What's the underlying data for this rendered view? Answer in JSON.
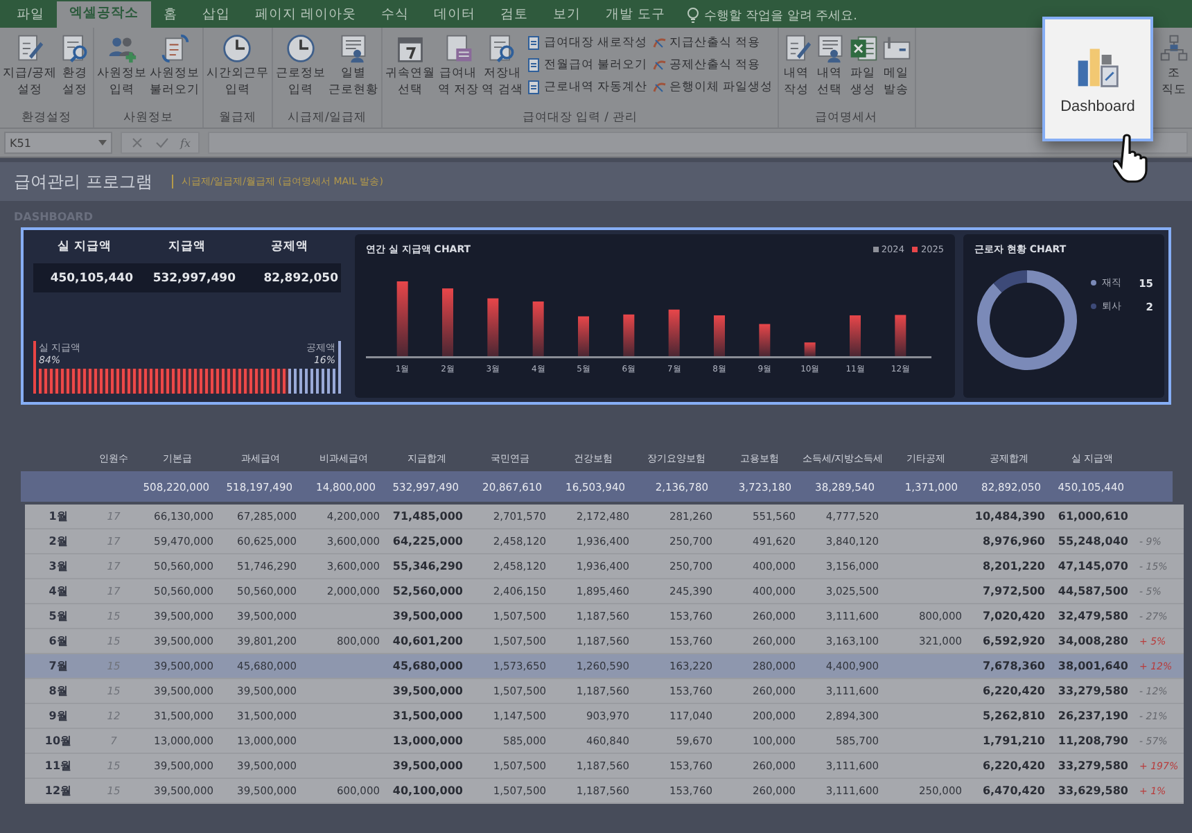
{
  "ribbon_tabs": [
    {
      "label": "파일",
      "selected": false
    },
    {
      "label": "엑셀공작소",
      "selected": true
    },
    {
      "label": "홈",
      "selected": false
    },
    {
      "label": "삽입",
      "selected": false
    },
    {
      "label": "페이지 레이아웃",
      "selected": false
    },
    {
      "label": "수식",
      "selected": false
    },
    {
      "label": "데이터",
      "selected": false
    },
    {
      "label": "검토",
      "selected": false
    },
    {
      "label": "보기",
      "selected": false
    },
    {
      "label": "개발 도구",
      "selected": false
    }
  ],
  "tell_me": "수행할 작업을 알려 주세요.",
  "ribbon_groups": [
    {
      "label": "환경설정",
      "buttons": [
        {
          "lines": [
            "지급/공제",
            "설정"
          ]
        },
        {
          "lines": [
            "환경",
            "설정"
          ]
        }
      ]
    },
    {
      "label": "사원정보",
      "buttons": [
        {
          "lines": [
            "사원정보",
            "입력"
          ]
        },
        {
          "lines": [
            "사원정보",
            "불러오기"
          ]
        }
      ]
    },
    {
      "label": "월급제",
      "buttons": [
        {
          "lines": [
            "시간외근무",
            "입력"
          ]
        }
      ]
    },
    {
      "label": "시급제/일급제",
      "buttons": [
        {
          "lines": [
            "근로정보",
            "입력"
          ]
        },
        {
          "lines": [
            "일별",
            "근로현황"
          ]
        }
      ]
    },
    {
      "label": "급여대장 입력 / 관리",
      "buttons": [
        {
          "lines": [
            "귀속연월",
            "선택"
          ]
        },
        {
          "lines": [
            "급여내",
            "역 저장"
          ]
        },
        {
          "lines": [
            "저장내",
            "역 검색"
          ]
        }
      ],
      "small_buttons": [
        [
          "급여대장 새로작성",
          "전월급여 불러오기",
          "근로내역 자동계산"
        ],
        [
          "지급산출식 적용",
          "공제산출식 적용",
          "은행이체 파일생성"
        ]
      ]
    },
    {
      "label": "급여명세서",
      "buttons": [
        {
          "lines": [
            "내역",
            "작성"
          ]
        },
        {
          "lines": [
            "내역",
            "선택"
          ]
        },
        {
          "lines": [
            "파일",
            "생성"
          ]
        },
        {
          "lines": [
            "메일",
            "발송"
          ]
        }
      ]
    },
    {
      "buttons": [
        {
          "lines": [
            "조",
            "직도"
          ]
        }
      ]
    }
  ],
  "dashboard_button": {
    "label": "Dashboard"
  },
  "formula_bar": {
    "name_box": "K51",
    "function_label": "fx"
  },
  "sheet": {
    "title": "급여관리 프로그램",
    "subtitle": "시급제/일급제/월급제 (급여명세서 MAIL 발송)",
    "section_label": "DASHBOARD"
  },
  "summary": {
    "headers": [
      "실 지급액",
      "지급액",
      "공제액"
    ],
    "values": [
      "450,105,440",
      "532,997,490",
      "82,892,050"
    ],
    "ratio": {
      "left_label": "실 지급액",
      "left_percent": "84%",
      "right_label": "공제액",
      "right_percent": "16%",
      "level": 0.84
    }
  },
  "annual_chart": {
    "title": "연간 실 지급액 CHART",
    "legend": [
      {
        "label": "2024",
        "color": "#8e9099"
      },
      {
        "label": "2025",
        "color": "#e8464a"
      }
    ],
    "months": [
      "1월",
      "2월",
      "3월",
      "4월",
      "5월",
      "6월",
      "7월",
      "8월",
      "9월",
      "10월",
      "11월",
      "12월"
    ]
  },
  "staff_chart": {
    "chart_data": {
      "type": "donut",
      "title": "근로자 현황 CHART",
      "categories": [
        "재직",
        "퇴사"
      ],
      "values": [
        15,
        2
      ],
      "data_labels": true,
      "legend": "right"
    }
  },
  "table": {
    "columns": [
      "",
      "인원수",
      "기본급",
      "과세급여",
      "비과세급여",
      "지급합계",
      "국민연금",
      "건강보험",
      "장기요양보험",
      "고용보험",
      "소득세/지방소득세",
      "기타공제",
      "공제합계",
      "실 지급액"
    ],
    "total": [
      "508,220,000",
      "518,197,490",
      "14,800,000",
      "532,997,490",
      "20,867,610",
      "16,503,940",
      "2,136,780",
      "3,723,180",
      "38,289,540",
      "1,371,000",
      "82,892,050",
      "450,105,440"
    ],
    "rows": [
      {
        "cells": [
          "1월",
          "17",
          "66,130,000",
          "67,285,000",
          "4,200,000",
          "71,485,000",
          "2,701,570",
          "2,172,480",
          "281,260",
          "551,560",
          "4,777,520",
          "",
          "10,484,390",
          "61,000,610"
        ],
        "selected": false
      },
      {
        "cells": [
          "2월",
          "17",
          "59,470,000",
          "60,625,000",
          "3,600,000",
          "64,225,000",
          "2,458,120",
          "1,936,400",
          "250,700",
          "491,620",
          "3,840,120",
          "",
          "8,976,960",
          "55,248,040"
        ],
        "change": "- 9%",
        "color": "#66686e",
        "selected": false
      },
      {
        "cells": [
          "3월",
          "17",
          "50,560,000",
          "51,746,290",
          "3,600,000",
          "55,346,290",
          "2,458,120",
          "1,936,400",
          "250,700",
          "400,000",
          "3,156,000",
          "",
          "8,201,220",
          "47,145,070"
        ],
        "change": "- 15%",
        "color": "#66686e",
        "selected": false
      },
      {
        "cells": [
          "4월",
          "17",
          "50,560,000",
          "50,560,000",
          "2,000,000",
          "52,560,000",
          "2,406,150",
          "1,895,460",
          "245,390",
          "400,000",
          "3,025,500",
          "",
          "7,972,500",
          "44,587,500"
        ],
        "change": "- 5%",
        "color": "#66686e",
        "selected": false
      },
      {
        "cells": [
          "5월",
          "15",
          "39,500,000",
          "39,500,000",
          "",
          "39,500,000",
          "1,507,500",
          "1,187,560",
          "153,760",
          "260,000",
          "3,111,600",
          "800,000",
          "7,020,420",
          "32,479,580"
        ],
        "change": "- 27%",
        "color": "#66686e",
        "selected": false
      },
      {
        "cells": [
          "6월",
          "15",
          "39,500,000",
          "39,801,200",
          "800,000",
          "40,601,200",
          "1,507,500",
          "1,187,560",
          "153,760",
          "260,000",
          "3,163,100",
          "321,000",
          "6,592,920",
          "34,008,280"
        ],
        "change": "+ 5%",
        "color": "#b83c3c",
        "selected": false
      },
      {
        "cells": [
          "7월",
          "15",
          "39,500,000",
          "45,680,000",
          "",
          "45,680,000",
          "1,573,650",
          "1,260,590",
          "163,220",
          "280,000",
          "4,400,900",
          "",
          "7,678,360",
          "38,001,640"
        ],
        "change": "+ 12%",
        "color": "#b83c3c",
        "selected": true
      },
      {
        "cells": [
          "8월",
          "15",
          "39,500,000",
          "39,500,000",
          "",
          "39,500,000",
          "1,507,500",
          "1,187,560",
          "153,760",
          "260,000",
          "3,111,600",
          "",
          "6,220,420",
          "33,279,580"
        ],
        "change": "- 12%",
        "color": "#66686e",
        "selected": false
      },
      {
        "cells": [
          "9월",
          "12",
          "31,500,000",
          "31,500,000",
          "",
          "31,500,000",
          "1,147,500",
          "903,970",
          "117,040",
          "200,000",
          "2,894,300",
          "",
          "5,262,810",
          "26,237,190"
        ],
        "change": "- 21%",
        "color": "#66686e",
        "selected": false
      },
      {
        "cells": [
          "10월",
          "7",
          "13,000,000",
          "13,000,000",
          "",
          "13,000,000",
          "585,000",
          "460,840",
          "59,670",
          "100,000",
          "585,700",
          "",
          "1,791,210",
          "11,208,790"
        ],
        "change": "- 57%",
        "color": "#66686e",
        "selected": false
      },
      {
        "cells": [
          "11월",
          "15",
          "39,500,000",
          "39,500,000",
          "",
          "39,500,000",
          "1,507,500",
          "1,187,560",
          "153,760",
          "260,000",
          "3,111,600",
          "",
          "6,220,420",
          "33,279,580"
        ],
        "change": "+ 197%",
        "color": "#b83c3c",
        "selected": false
      },
      {
        "cells": [
          "12월",
          "15",
          "39,500,000",
          "39,500,000",
          "600,000",
          "40,100,000",
          "1,507,500",
          "1,187,560",
          "153,760",
          "260,000",
          "3,111,600",
          "250,000",
          "6,470,420",
          "33,629,580"
        ],
        "change": "+ 1%",
        "color": "#b83c3c",
        "selected": false
      }
    ]
  }
}
